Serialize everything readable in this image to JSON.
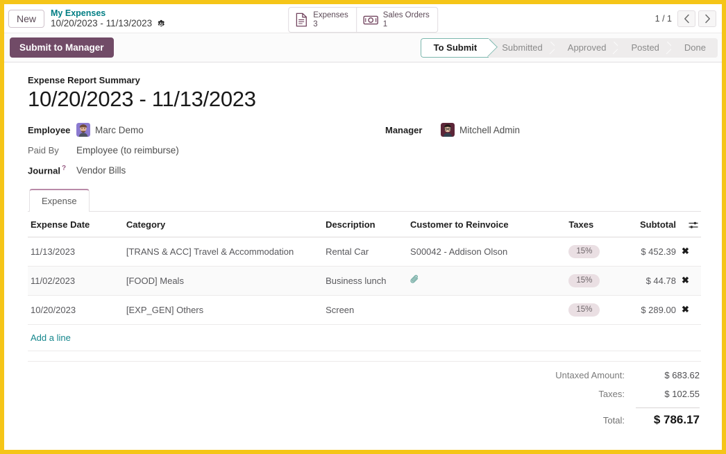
{
  "control_panel": {
    "new_button": "New",
    "breadcrumb_parent": "My Expenses",
    "breadcrumb_title": "10/20/2023 - 11/13/2023",
    "settings_icon": "gear-icon",
    "stat_buttons": [
      {
        "label": "Expenses",
        "value": "3",
        "icon": "document-icon"
      },
      {
        "label": "Sales Orders",
        "value": "1",
        "icon": "banknote-icon"
      }
    ],
    "pager": {
      "count": "1 / 1",
      "previous_icon": "chevron-left-icon",
      "next_icon": "chevron-right-icon"
    }
  },
  "status_bar": {
    "action_button": "Submit to Manager",
    "stages": [
      {
        "label": "To Submit",
        "active": true
      },
      {
        "label": "Submitted",
        "active": false
      },
      {
        "label": "Approved",
        "active": false
      },
      {
        "label": "Posted",
        "active": false
      },
      {
        "label": "Done",
        "active": false
      }
    ]
  },
  "form": {
    "summary_label": "Expense Report Summary",
    "summary_title": "10/20/2023 - 11/13/2023",
    "fields": {
      "employee_label": "Employee",
      "employee_value": "Marc Demo",
      "paid_by_label": "Paid By",
      "paid_by_value": "Employee (to reimburse)",
      "journal_label": "Journal",
      "journal_help": "?",
      "journal_value": "Vendor Bills",
      "manager_label": "Manager",
      "manager_value": "Mitchell Admin"
    }
  },
  "notebook": {
    "tabs": [
      {
        "label": "Expense",
        "active": true
      }
    ]
  },
  "table": {
    "columns": [
      "Expense Date",
      "Category",
      "Description",
      "Customer to Reinvoice",
      "Taxes",
      "Subtotal"
    ],
    "optional_columns_icon": "sliders-icon",
    "rows": [
      {
        "date": "11/13/2023",
        "category": "[TRANS & ACC] Travel & Accommodation",
        "description": "Rental Car",
        "customer": "S00042 - Addison Olson",
        "tax": "15%",
        "attachment": false,
        "subtotal": "$ 452.39",
        "delete_icon": "close-icon"
      },
      {
        "date": "11/02/2023",
        "category": "[FOOD] Meals",
        "description": "Business lunch",
        "customer": "",
        "tax": "15%",
        "attachment": true,
        "subtotal": "$ 44.78",
        "delete_icon": "close-icon"
      },
      {
        "date": "10/20/2023",
        "category": "[EXP_GEN] Others",
        "description": "Screen",
        "customer": "",
        "tax": "15%",
        "attachment": false,
        "subtotal": "$ 289.00",
        "delete_icon": "close-icon"
      }
    ],
    "add_line": "Add a line"
  },
  "totals": {
    "untaxed_label": "Untaxed Amount:",
    "untaxed_value": "$ 683.62",
    "taxes_label": "Taxes:",
    "taxes_value": "$ 102.55",
    "total_label": "Total:",
    "total_value": "$ 786.17"
  },
  "colors": {
    "brand_purple": "#714B67",
    "link_teal": "#017E84",
    "stage_active_border": "#7BB7AD",
    "badge_bg": "#EADFE3",
    "frame": "#F5C518"
  }
}
